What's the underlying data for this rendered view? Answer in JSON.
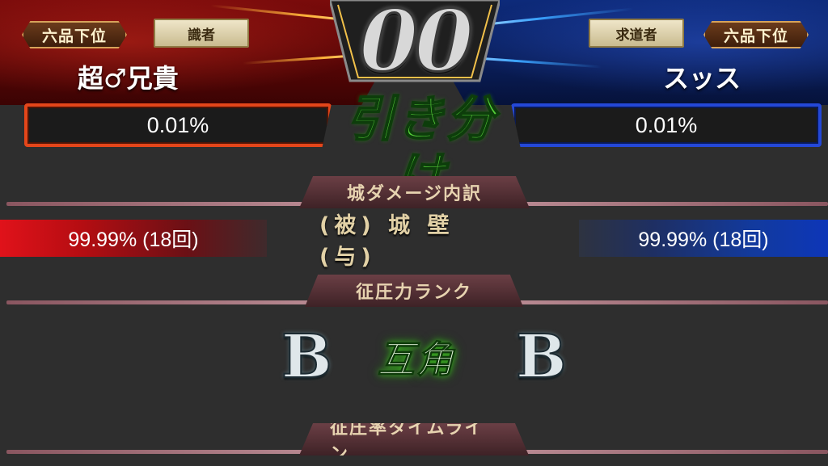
{
  "header": {
    "left_player": {
      "rank": "六品下位",
      "class": "識者",
      "name": "超♂兄貴",
      "conquest_rate": "0.01%"
    },
    "right_player": {
      "rank": "六品下位",
      "class": "求道者",
      "name": "スッス",
      "conquest_rate": "0.01%"
    },
    "score": "00",
    "result": "引き分け",
    "colors": {
      "left_team": "#c0121a",
      "right_team": "#1a3fc0",
      "result_green": "#57d03a"
    }
  },
  "sections": {
    "damage_breakdown": {
      "title": "城ダメージ内訳",
      "left_value": "99.99% (18回)",
      "label": "(被) 城 壁 (与)",
      "right_value": "99.99% (18回)"
    },
    "conquest_rank": {
      "title": "征圧力ランク",
      "left_grade": "B",
      "result": "互角",
      "right_grade": "B"
    },
    "timeline": {
      "title": "征圧率タイムライン"
    }
  }
}
